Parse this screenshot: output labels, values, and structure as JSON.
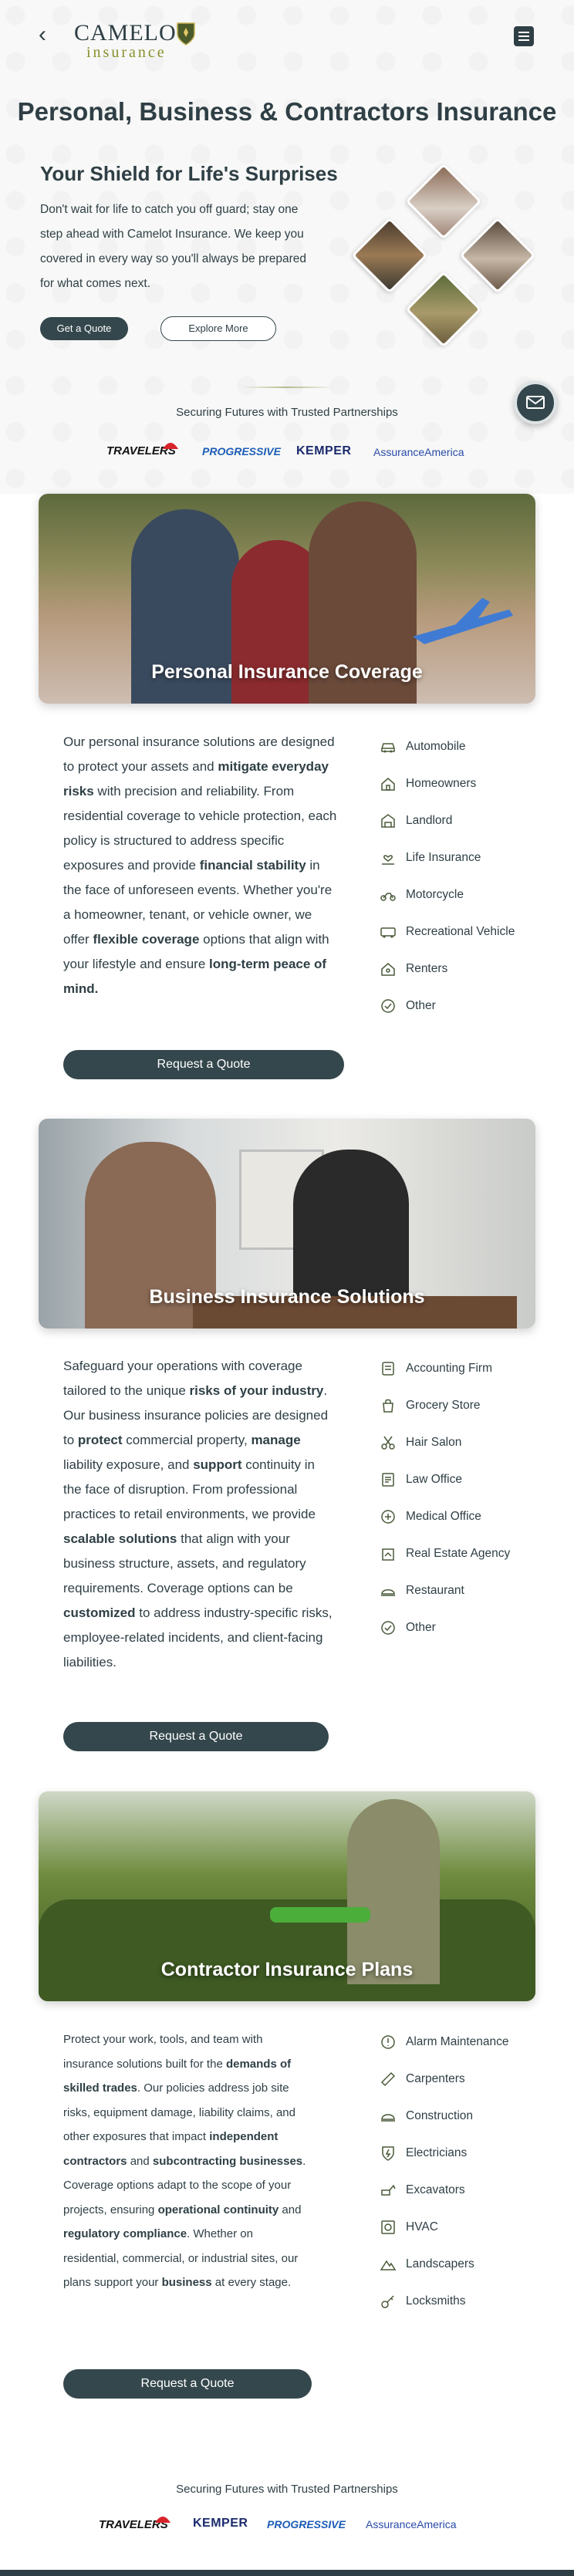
{
  "header": {
    "back_label": "‹",
    "logo_top": "CAMELOT",
    "logo_bottom": "insurance",
    "menu_icon": "menu-icon"
  },
  "page_title": "Personal, Business & Contractors Insurance",
  "hero": {
    "title": "Your Shield for Life's Surprises",
    "text": "Don't wait for life to catch you off guard; stay one step ahead with Camelot Insurance. We keep you covered in every way so you'll always be prepared for what comes next.",
    "primary_button": "Get a Quote",
    "secondary_button": "Explore More"
  },
  "partners_label": "Securing Futures with Trusted Partnerships",
  "partners_top": [
    "TRAVELERS",
    "PROGRESSIVE",
    "KEMPER",
    "AssuranceAmerica"
  ],
  "partners_bottom": [
    "TRAVELERS",
    "KEMPER",
    "PROGRESSIVE",
    "AssuranceAmerica"
  ],
  "personal": {
    "image_title": "Personal Insurance Coverage",
    "p1": "Our personal insurance solutions are designed to protect your assets and ",
    "b1": "mitigate everyday risks",
    "p2": " with precision and reliability. From residential coverage to vehicle protection, each policy is structured to address specific exposures and provide ",
    "b2": "financial stability",
    "p3": " in the face of unforeseen events. Whether you're a homeowner, tenant, or vehicle owner, we offer ",
    "b3": "flexible coverage",
    "p4": " options that align with your lifestyle and ensure ",
    "b4": "long-term peace of mind.",
    "button": "Request a Quote",
    "items": [
      "Automobile",
      "Homeowners",
      "Landlord",
      "Life Insurance",
      "Motorcycle",
      "Recreational Vehicle",
      "Renters",
      "Other"
    ]
  },
  "business": {
    "image_title": "Business Insurance Solutions",
    "p1": "Safeguard your operations with coverage tailored to the unique ",
    "b1": "risks of your industry",
    "p2": ". Our business insurance policies are designed to ",
    "b2": "protect",
    "p3": " commercial property, ",
    "b3": "manage",
    "p4": " liability exposure, and ",
    "b4": "support",
    "p5": " continuity in the face of disruption. From professional practices to retail environments, we provide ",
    "b5": "scalable solutions",
    "p6": " that align with your business structure, assets, and regulatory requirements. Coverage options can be ",
    "b6": "customized",
    "p7": " to address industry-specific risks, employee-related incidents, and client-facing liabilities.",
    "button": "Request a Quote",
    "items": [
      "Accounting Firm",
      "Grocery Store",
      "Hair Salon",
      "Law Office",
      "Medical Office",
      "Real Estate Agency",
      "Restaurant",
      "Other"
    ]
  },
  "contractor": {
    "image_title": "Contractor Insurance Plans",
    "p1": "Protect your work, tools, and team with insurance solutions built for the ",
    "b1": "demands of skilled trades",
    "p2": ". Our policies address job site risks, equipment damage, liability claims, and other exposures that impact ",
    "b2": "independent contractors",
    "p3": " and ",
    "b3": "subcontracting businesses",
    "p4": ". Coverage options adapt to the scope of your projects, ensuring ",
    "b4": "operational continuity",
    "p5": " and ",
    "b5": "regulatory compliance",
    "p6": ". Whether on residential, commercial, or industrial sites, our plans support your ",
    "b6": "business",
    "p7": " at every stage.",
    "button": "Request a Quote",
    "items": [
      "Alarm Maintenance",
      "Carpenters",
      "Construction",
      "Electricians",
      "Excavators",
      "HVAC",
      "Landscapers",
      "Locksmiths"
    ]
  },
  "colors": {
    "primary": "#34474d",
    "accent": "#8a8f2a",
    "travelers_red": "#d8232a",
    "progressive_blue": "#1d5db6"
  }
}
